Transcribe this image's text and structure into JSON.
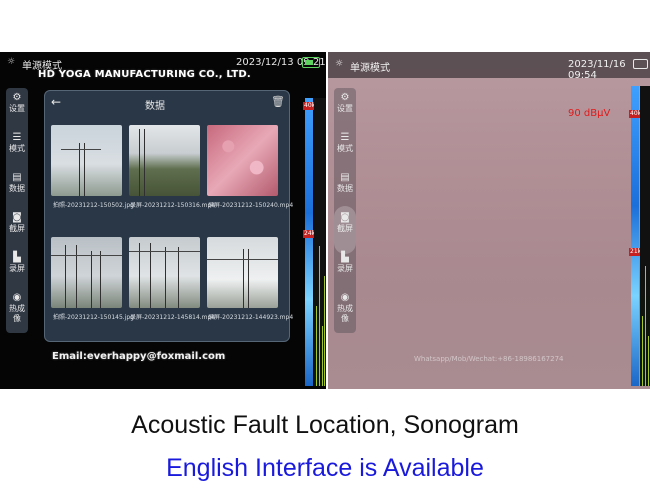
{
  "left_screen": {
    "status_title": "单源模式",
    "status_time": "2023/12/13 09:21",
    "watermark_top": "HD YOGA MANUFACTURING CO., LTD.",
    "watermark_bottom": "Email:everhappy@foxmail.com",
    "sidebar": [
      {
        "label": "设置",
        "icon": "gear-icon"
      },
      {
        "label": "模式",
        "icon": "menu-icon"
      },
      {
        "label": "数据",
        "icon": "document-icon"
      },
      {
        "label": "截屏",
        "icon": "camera-icon"
      },
      {
        "label": "录屏",
        "icon": "video-icon"
      },
      {
        "label": "热成像",
        "icon": "location-icon"
      }
    ],
    "dialog": {
      "title": "数据",
      "files": [
        "拍照-20231212-150502.jpg",
        "录屏-20231212-150316.mp4",
        "录屏-20231212-150240.mp4",
        "拍照-20231212-150145.jpg",
        "录屏-20231212-145814.mp4",
        "录屏-20231212-144923.mp4"
      ]
    },
    "scale_top": "40k",
    "scale_bottom": "24k"
  },
  "right_screen": {
    "status_title": "单源模式",
    "status_time": "2023/11/16 09:54",
    "reading": "90 dBμV",
    "watermark_bottom": "Whatsapp/Mob/Wechat:+86-18986167274",
    "sidebar": [
      {
        "label": "设置",
        "icon": "gear-icon"
      },
      {
        "label": "模式",
        "icon": "menu-icon"
      },
      {
        "label": "数据",
        "icon": "document-icon"
      },
      {
        "label": "截屏",
        "icon": "camera-icon"
      },
      {
        "label": "录屏",
        "icon": "video-icon"
      },
      {
        "label": "热成像",
        "icon": "location-icon"
      }
    ],
    "scale_top": "40k",
    "scale_bottom": "21k"
  },
  "captions": {
    "line1": "Acoustic Fault Location, Sonogram",
    "line2": "English Interface is Available"
  },
  "colors": {
    "caption2": "#1a1adc",
    "reading": "#e01a1a",
    "battery": "#5fd35f"
  }
}
